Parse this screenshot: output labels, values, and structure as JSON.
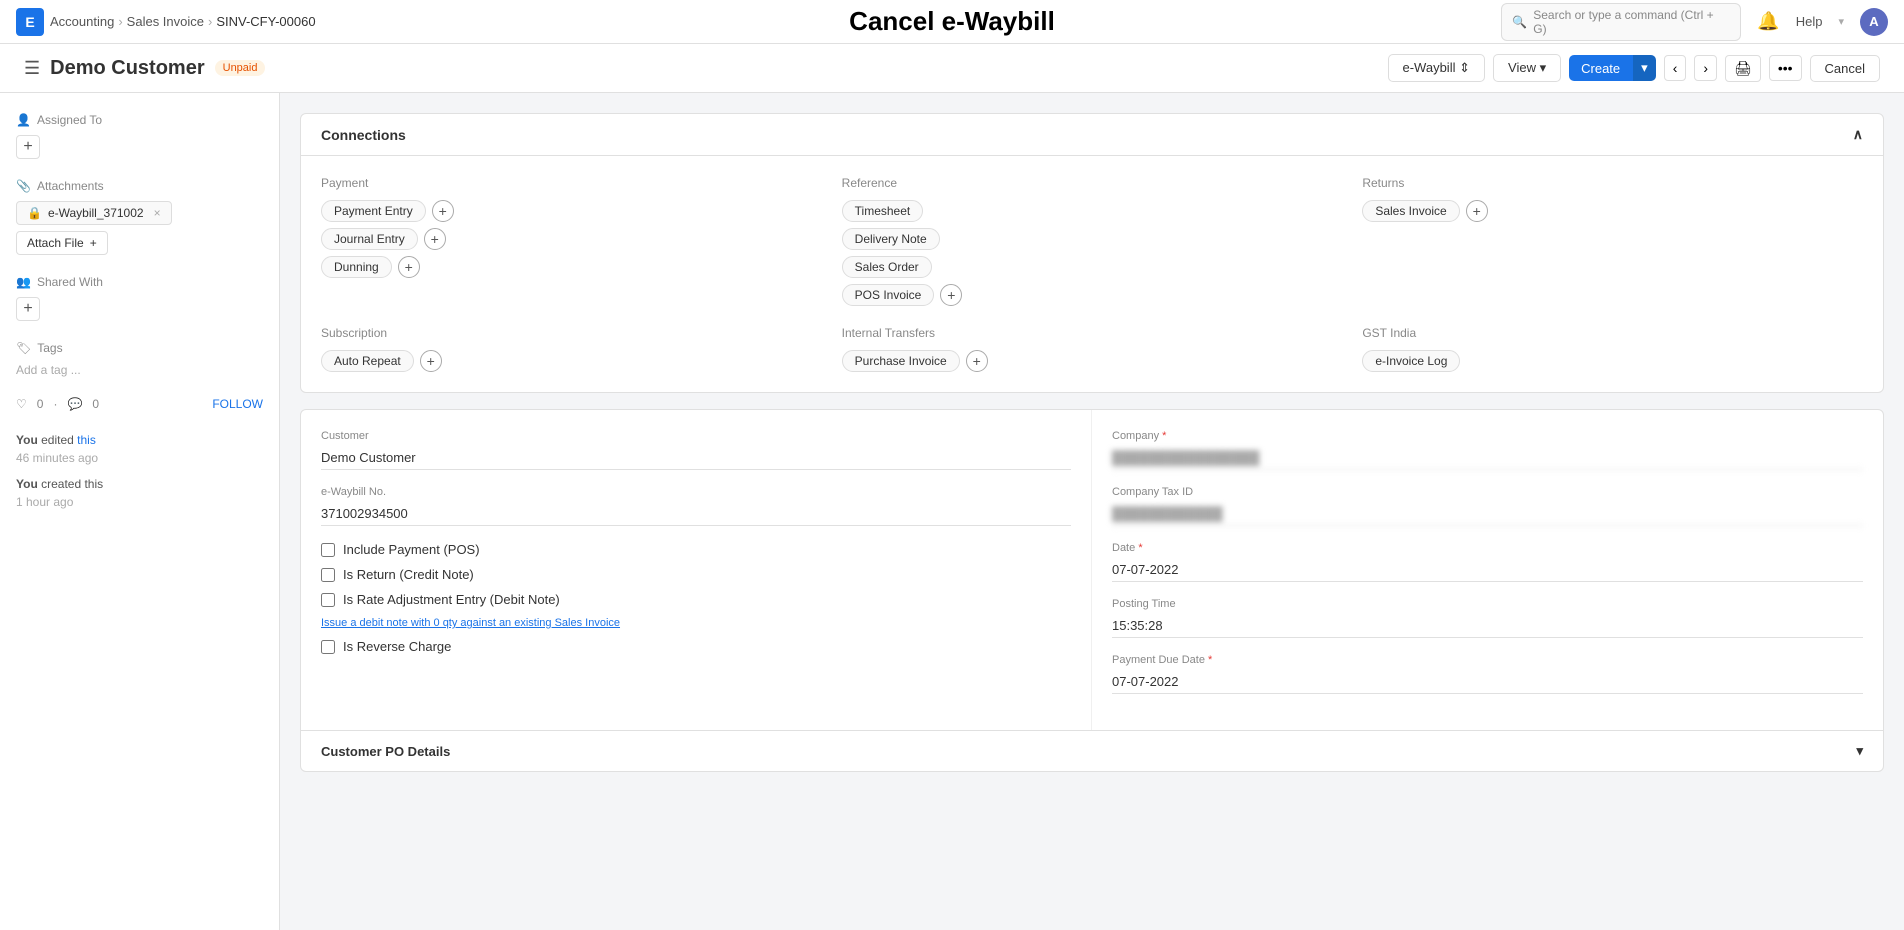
{
  "app": {
    "icon": "E",
    "icon_color": "#1a73e8"
  },
  "breadcrumb": {
    "accounting": "Accounting",
    "sales_invoice": "Sales Invoice",
    "doc_id": "SINV-CFY-00060"
  },
  "modal_title": "Cancel e-Waybill",
  "search": {
    "placeholder": "Search or type a command (Ctrl + G)"
  },
  "nav_right": {
    "help": "Help",
    "avatar": "A"
  },
  "document": {
    "title": "Demo Customer",
    "status": "Unpaid",
    "status_color": "#e65100"
  },
  "actions": {
    "ewaybill": "e-Waybill",
    "view": "View",
    "create": "Create",
    "cancel": "Cancel"
  },
  "sidebar": {
    "assigned_to_label": "Assigned To",
    "attachments_label": "Attachments",
    "attachment_file": "e-Waybill_371002",
    "attach_file_label": "Attach File",
    "shared_with_label": "Shared With",
    "tags_label": "Tags",
    "add_tag_placeholder": "Add a tag ...",
    "likes": "0",
    "comments": "0",
    "follow_label": "FOLLOW",
    "activity": [
      {
        "action": "You",
        "verb": "edited",
        "link": "this",
        "time": "46 minutes ago"
      },
      {
        "action": "You",
        "verb": "created this",
        "link": "",
        "time": "1 hour ago"
      }
    ]
  },
  "connections": {
    "section_title": "Connections",
    "payment": {
      "title": "Payment",
      "items": [
        "Payment Entry",
        "Journal Entry",
        "Dunning"
      ]
    },
    "reference": {
      "title": "Reference",
      "items": [
        "Timesheet",
        "Delivery Note",
        "Sales Order",
        "POS Invoice"
      ]
    },
    "returns": {
      "title": "Returns",
      "items": [
        "Sales Invoice"
      ]
    },
    "subscription": {
      "title": "Subscription",
      "items": [
        "Auto Repeat"
      ]
    },
    "internal_transfers": {
      "title": "Internal Transfers",
      "items": [
        "Purchase Invoice"
      ]
    },
    "gst_india": {
      "title": "GST India",
      "items": [
        "e-Invoice Log"
      ]
    }
  },
  "form": {
    "customer_label": "Customer",
    "customer_value": "Demo Customer",
    "ewaybill_no_label": "e-Waybill No.",
    "ewaybill_no_value": "371002934500",
    "include_payment_label": "Include Payment (POS)",
    "is_return_label": "Is Return (Credit Note)",
    "is_rate_adjustment_label": "Is Rate Adjustment Entry (Debit Note)",
    "debit_note_hint": "Issue a debit note with 0 qty against an existing Sales Invoice",
    "is_reverse_charge_label": "Is Reverse Charge",
    "company_label": "Company",
    "company_value": "████████████████",
    "company_tax_id_label": "Company Tax ID",
    "company_tax_id_value": "████████████",
    "date_label": "Date",
    "date_required": true,
    "date_value": "07-07-2022",
    "posting_time_label": "Posting Time",
    "posting_time_value": "15:35:28",
    "payment_due_date_label": "Payment Due Date",
    "payment_due_date_required": true,
    "payment_due_date_value": "07-07-2022"
  },
  "customer_po": {
    "title": "Customer PO Details"
  }
}
